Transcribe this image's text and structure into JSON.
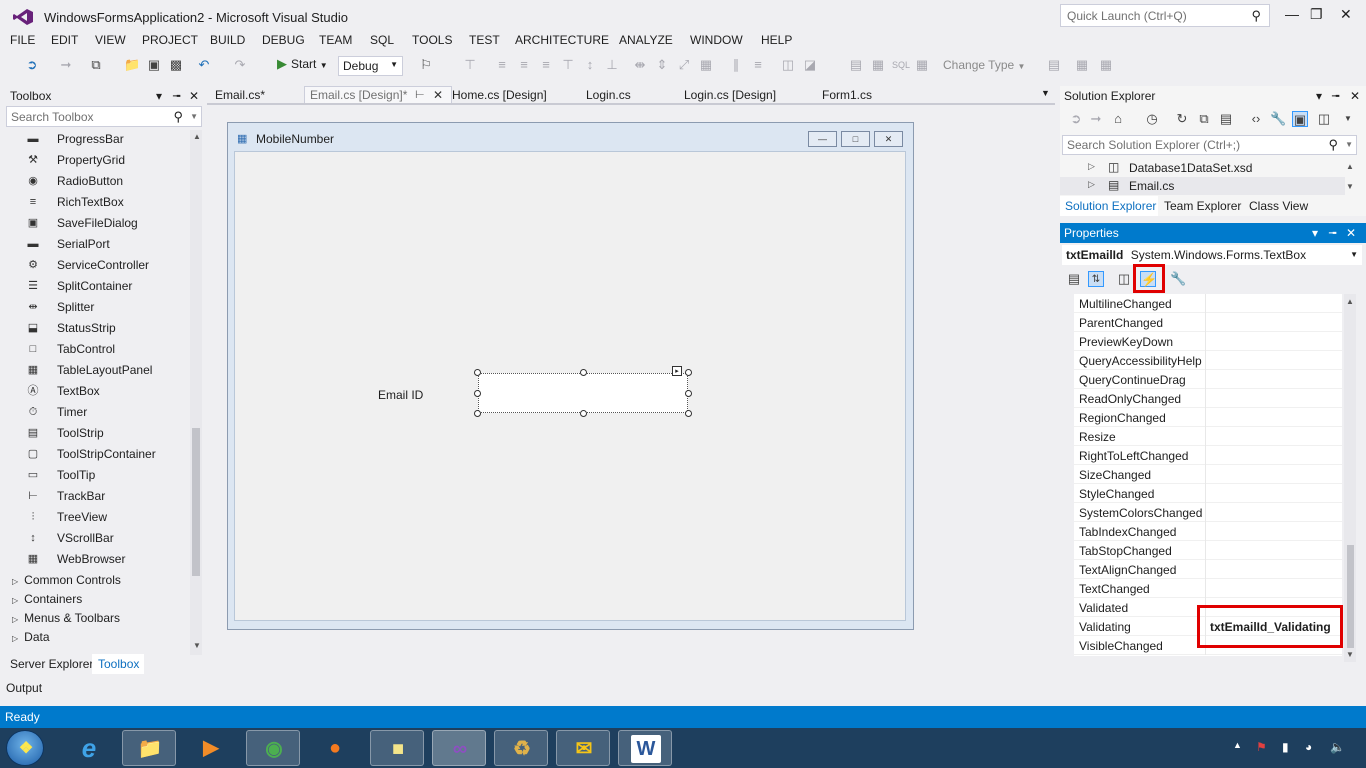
{
  "window": {
    "title": "WindowsFormsApplication2 - Microsoft Visual Studio"
  },
  "quick_launch": {
    "placeholder": "Quick Launch (Ctrl+Q)"
  },
  "menu": [
    "FILE",
    "EDIT",
    "VIEW",
    "PROJECT",
    "BUILD",
    "DEBUG",
    "TEAM",
    "SQL",
    "TOOLS",
    "TEST",
    "ARCHITECTURE",
    "ANALYZE",
    "WINDOW",
    "HELP"
  ],
  "toolbar": {
    "start_label": "Start",
    "configuration": "Debug",
    "change_type": "Change Type"
  },
  "toolbox": {
    "title": "Toolbox",
    "search_placeholder": "Search Toolbox",
    "items": [
      {
        "label": "ProgressBar",
        "icon": "progressbar-icon"
      },
      {
        "label": "PropertyGrid",
        "icon": "propertygrid-icon"
      },
      {
        "label": "RadioButton",
        "icon": "radiobutton-icon"
      },
      {
        "label": "RichTextBox",
        "icon": "richtextbox-icon"
      },
      {
        "label": "SaveFileDialog",
        "icon": "savefiledialog-icon"
      },
      {
        "label": "SerialPort",
        "icon": "serialport-icon"
      },
      {
        "label": "ServiceController",
        "icon": "servicecontroller-icon"
      },
      {
        "label": "SplitContainer",
        "icon": "splitcontainer-icon"
      },
      {
        "label": "Splitter",
        "icon": "splitter-icon"
      },
      {
        "label": "StatusStrip",
        "icon": "statusstrip-icon"
      },
      {
        "label": "TabControl",
        "icon": "tabcontrol-icon"
      },
      {
        "label": "TableLayoutPanel",
        "icon": "tablelayoutpanel-icon"
      },
      {
        "label": "TextBox",
        "icon": "textbox-icon"
      },
      {
        "label": "Timer",
        "icon": "timer-icon"
      },
      {
        "label": "ToolStrip",
        "icon": "toolstrip-icon"
      },
      {
        "label": "ToolStripContainer",
        "icon": "toolstripcontainer-icon"
      },
      {
        "label": "ToolTip",
        "icon": "tooltip-icon"
      },
      {
        "label": "TrackBar",
        "icon": "trackbar-icon"
      },
      {
        "label": "TreeView",
        "icon": "treeview-icon"
      },
      {
        "label": "VScrollBar",
        "icon": "vscrollbar-icon"
      },
      {
        "label": "WebBrowser",
        "icon": "webbrowser-icon"
      }
    ],
    "categories": [
      "Common Controls",
      "Containers",
      "Menus & Toolbars",
      "Data"
    ],
    "bottom_tabs": [
      "Server Explorer",
      "Toolbox"
    ]
  },
  "doc_tabs": [
    {
      "label": "Email.cs*",
      "active": false
    },
    {
      "label": "Email.cs [Design]*",
      "active": true
    },
    {
      "label": "Home.cs [Design]",
      "active": false
    },
    {
      "label": "Login.cs",
      "active": false
    },
    {
      "label": "Login.cs [Design]",
      "active": false
    },
    {
      "label": "Form1.cs",
      "active": false
    }
  ],
  "form": {
    "title": "MobileNumber",
    "label": "Email ID"
  },
  "solution_explorer": {
    "title": "Solution Explorer",
    "search_placeholder": "Search Solution Explorer (Ctrl+;)",
    "items": [
      "Database1DataSet.xsd",
      "Email.cs"
    ],
    "tabs": [
      "Solution Explorer",
      "Team Explorer",
      "Class View"
    ]
  },
  "properties": {
    "title": "Properties",
    "object_name": "txtEmailId",
    "object_type": "System.Windows.Forms.TextBox",
    "rows": [
      {
        "name": "MultilineChanged",
        "value": ""
      },
      {
        "name": "ParentChanged",
        "value": ""
      },
      {
        "name": "PreviewKeyDown",
        "value": ""
      },
      {
        "name": "QueryAccessibilityHelp",
        "value": ""
      },
      {
        "name": "QueryContinueDrag",
        "value": ""
      },
      {
        "name": "ReadOnlyChanged",
        "value": ""
      },
      {
        "name": "RegionChanged",
        "value": ""
      },
      {
        "name": "Resize",
        "value": ""
      },
      {
        "name": "RightToLeftChanged",
        "value": ""
      },
      {
        "name": "SizeChanged",
        "value": ""
      },
      {
        "name": "StyleChanged",
        "value": ""
      },
      {
        "name": "SystemColorsChanged",
        "value": ""
      },
      {
        "name": "TabIndexChanged",
        "value": ""
      },
      {
        "name": "TabStopChanged",
        "value": ""
      },
      {
        "name": "TextAlignChanged",
        "value": ""
      },
      {
        "name": "TextChanged",
        "value": ""
      },
      {
        "name": "Validated",
        "value": ""
      },
      {
        "name": "Validating",
        "value": "txtEmailId_Validating"
      },
      {
        "name": "VisibleChanged",
        "value": ""
      }
    ]
  },
  "output": {
    "title": "Output"
  },
  "status": {
    "text": "Ready"
  },
  "colors": {
    "accent": "#007ACC",
    "highlight": "#E00000"
  }
}
